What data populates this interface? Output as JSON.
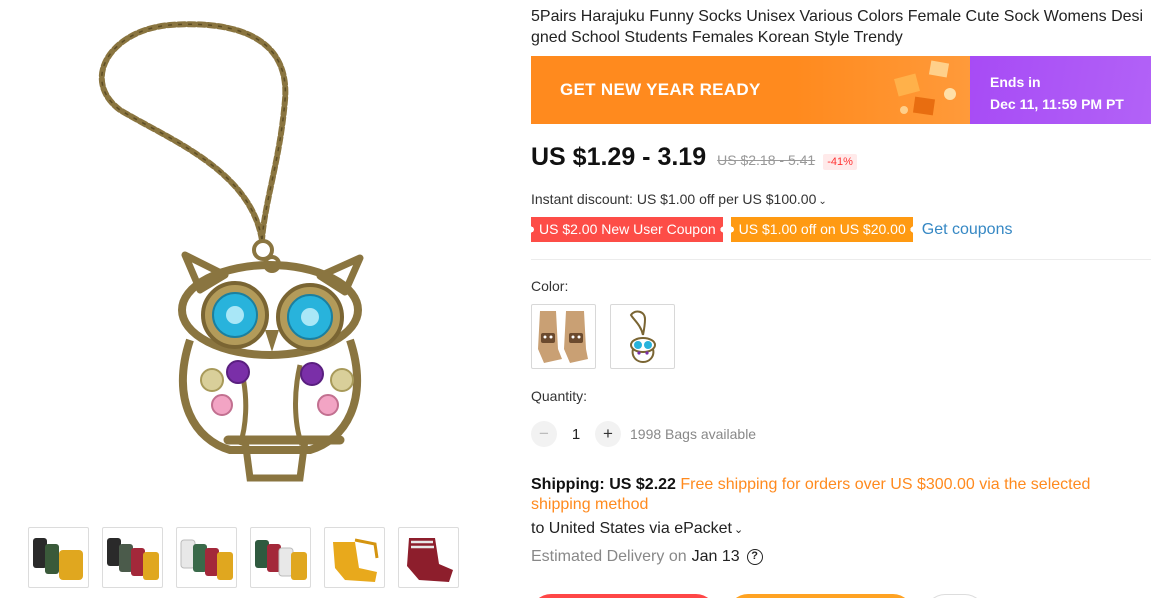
{
  "product": {
    "title": "5Pairs Harajuku Funny Socks Unisex Various Colors Female Cute Sock Womens Desi gned School Students Females Korean Style Trendy"
  },
  "promo": {
    "banner_text": "GET NEW YEAR READY",
    "ends_label": "Ends in",
    "ends_date": "Dec 11, 11:59 PM PT"
  },
  "price": {
    "current": "US $1.29 - 3.19",
    "original": "US $2.18 - 5.41",
    "discount": "-41%"
  },
  "instant_discount": "Instant discount: US $1.00 off per US $100.00",
  "coupons": {
    "items": [
      "US $2.00 New User Coupon",
      "US $1.00 off on US $20.00"
    ],
    "get_coupons_label": "Get coupons"
  },
  "color": {
    "label": "Color:",
    "options": [
      "socks-swatch",
      "owl-necklace-swatch"
    ]
  },
  "quantity": {
    "label": "Quantity:",
    "value": "1",
    "available": "1998 Bags available"
  },
  "shipping": {
    "label": "Shipping:",
    "cost": "US $2.22",
    "free_text": "Free shipping for orders over US $300.00 via the selected shipping method",
    "destination": "to United States via ePacket",
    "eta_label": "Estimated Delivery on",
    "eta_date": "Jan 13"
  },
  "gallery": {
    "thumbnails": [
      "socks-black-yellow",
      "socks-black-red-yellow",
      "socks-white-green",
      "socks-green-red-yellow",
      "socks-yellow",
      "socks-red"
    ]
  },
  "colors": {
    "promo_orange": "#ff8a1e",
    "promo_purple": "#a74bf5",
    "coupon_red": "#fd4d47",
    "coupon_orange": "#ff9a12",
    "link_blue": "#3688c4",
    "discount_red": "#ff3333"
  }
}
